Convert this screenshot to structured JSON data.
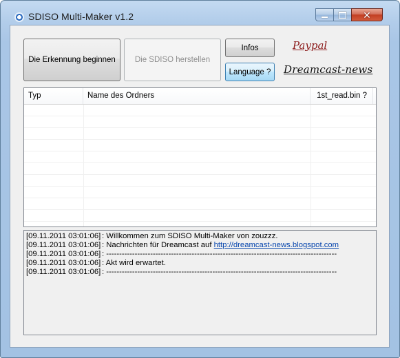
{
  "window": {
    "title": "SDISO Multi-Maker v1.2",
    "controls": {
      "minimize_icon": "minimize-icon",
      "maximize_icon": "maximize-icon",
      "close_icon": "close-icon"
    }
  },
  "toolbar": {
    "start_detection_label": "Die Erkennung beginnen",
    "create_sdiso_label": "Die SDISO herstellen",
    "infos_label": "Infos",
    "language_label": "Language ?",
    "paypal_link": "Paypal",
    "dreamcast_news_link": "Dreamcast-news"
  },
  "folder_list": {
    "columns": [
      "Typ",
      "Name des Ordners",
      "1st_read.bin ?"
    ],
    "rows": []
  },
  "log": {
    "lines": [
      {
        "timestamp": "[09.11.2011 03:01:06]",
        "text": ": Willkommen zum SDISO Multi-Maker von zouzzz."
      },
      {
        "timestamp": "[09.11.2011 03:01:06]",
        "text": ": Nachrichten für Dreamcast auf ",
        "link": "http://dreamcast-news.blogspot.com"
      },
      {
        "timestamp": "[09.11.2011 03:01:06]",
        "text": ": -----------------------------------------------------------------------------------------"
      },
      {
        "timestamp": "[09.11.2011 03:01:06]",
        "text": ": Akt wird erwartet."
      },
      {
        "timestamp": "[09.11.2011 03:01:06]",
        "text": ": -----------------------------------------------------------------------------------------"
      }
    ]
  },
  "colors": {
    "title_bar": "#b2cdea",
    "close_button": "#c23f23",
    "paypal_link": "#8b1a1a",
    "log_link": "#0645ad",
    "client_background": "#f0f0f0"
  }
}
